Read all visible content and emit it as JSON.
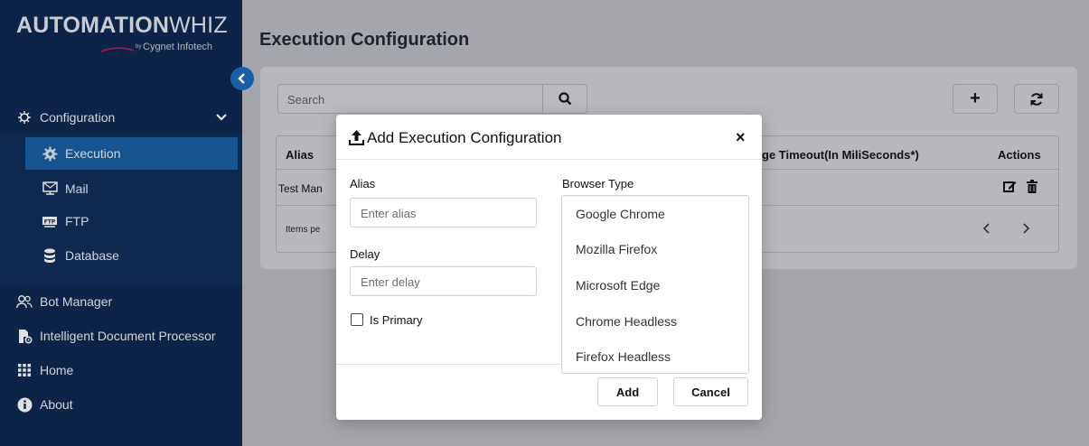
{
  "brand": {
    "name_bold": "AUTOMATION",
    "name_light": "WHIZ",
    "by": "by",
    "company": "Cygnet Infotech"
  },
  "sidebar": {
    "collapse_icon": "chevron-left-icon",
    "configuration": {
      "label": "Configuration",
      "icon": "gear-tree-icon"
    },
    "sub_items": [
      {
        "label": "Execution",
        "icon": "gear-icon",
        "active": true
      },
      {
        "label": "Mail",
        "icon": "mail-server-icon"
      },
      {
        "label": "FTP",
        "icon": "ftp-icon"
      },
      {
        "label": "Database",
        "icon": "database-icon"
      }
    ],
    "items": [
      {
        "label": "Bot Manager",
        "icon": "users-icon"
      },
      {
        "label": "Intelligent Document Processor",
        "icon": "document-gear-icon"
      },
      {
        "label": "Home",
        "icon": "grid-icon"
      },
      {
        "label": "About",
        "icon": "info-icon"
      }
    ]
  },
  "main": {
    "title": "Execution Configuration",
    "search_placeholder": "Search",
    "add_label": "+",
    "table": {
      "headers": {
        "alias": "Alias",
        "timeout": "ge Timeout(In MiliSeconds*)",
        "actions": "Actions"
      },
      "row_alias": "Test Man",
      "items_per_page": "Items pe"
    }
  },
  "modal": {
    "title": "Add Execution Configuration",
    "close": "×",
    "alias_label": "Alias",
    "alias_placeholder": "Enter alias",
    "delay_label": "Delay",
    "delay_placeholder": "Enter delay",
    "is_primary_label": "Is Primary",
    "browser_label": "Browser Type",
    "browser_options": [
      "Google Chrome",
      "Mozilla Firefox",
      "Microsoft Edge",
      "Chrome Headless",
      "Firefox Headless"
    ],
    "add_button": "Add",
    "cancel_button": "Cancel"
  },
  "colors": {
    "sidebar": "#0d2a52",
    "accent": "#1a5fa6",
    "overlay": "#a4a6ab"
  }
}
